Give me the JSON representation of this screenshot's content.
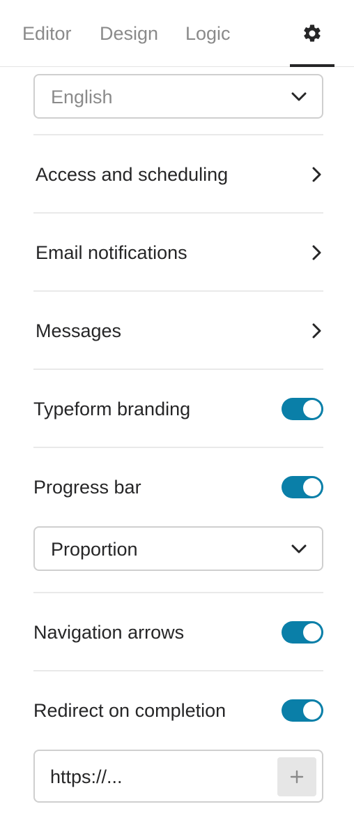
{
  "tabs": {
    "editor": "Editor",
    "design": "Design",
    "logic": "Logic",
    "settings_icon": "gear-icon",
    "active": "settings"
  },
  "language_select": {
    "value": "English",
    "icon": "chevron-down-icon"
  },
  "nav_items": [
    {
      "label": "Access and scheduling",
      "icon": "chevron-right-icon"
    },
    {
      "label": "Email notifications",
      "icon": "chevron-right-icon"
    },
    {
      "label": "Messages",
      "icon": "chevron-right-icon"
    }
  ],
  "toggles": {
    "typeform_branding": {
      "label": "Typeform branding",
      "on": true
    },
    "progress_bar": {
      "label": "Progress bar",
      "on": true
    },
    "navigation_arrows": {
      "label": "Navigation arrows",
      "on": true
    },
    "redirect_on_completion": {
      "label": "Redirect on completion",
      "on": true
    }
  },
  "progress_select": {
    "value": "Proportion",
    "icon": "chevron-down-icon"
  },
  "redirect_url": {
    "placeholder": "https://...",
    "add_icon": "plus-icon"
  },
  "colors": {
    "accent": "#0a7fa8",
    "text": "#262627",
    "muted": "#8a8a8a",
    "border": "#cfcfcf"
  }
}
